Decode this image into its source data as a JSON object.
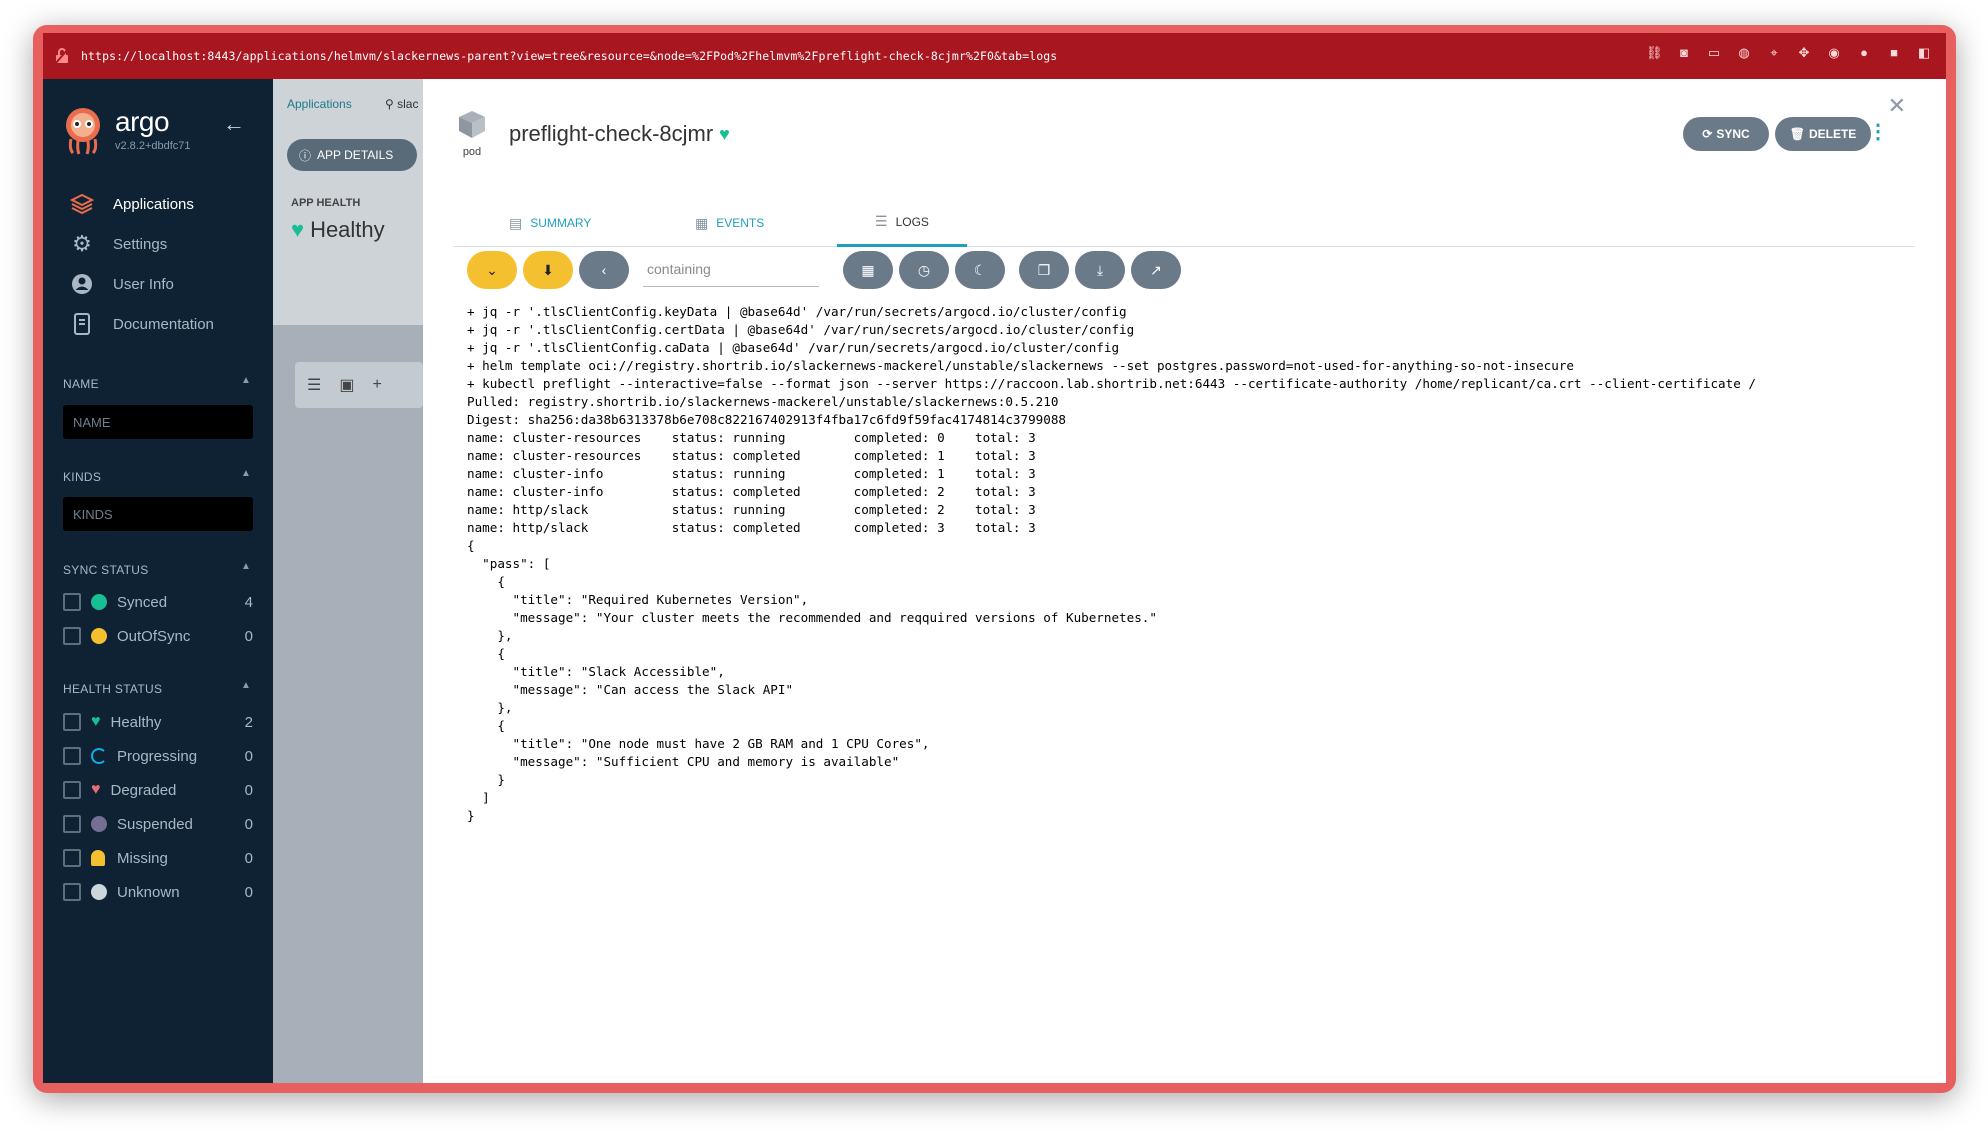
{
  "browser": {
    "url": "https://localhost:8443/applications/helmvm/slackernews-parent?view=tree&resource=&node=%2FPod%2Fhelmvm%2Fpreflight-check-8cjmr%2F0&tab=logs"
  },
  "sidebar": {
    "brand": "argo",
    "version": "v2.8.2+dbdfc71",
    "nav": [
      {
        "label": "Applications",
        "icon": "layers-icon"
      },
      {
        "label": "Settings",
        "icon": "gears-icon"
      },
      {
        "label": "User Info",
        "icon": "user-icon"
      },
      {
        "label": "Documentation",
        "icon": "book-icon"
      }
    ],
    "filters": {
      "name_title": "NAME",
      "name_placeholder": "NAME",
      "kinds_title": "KINDS",
      "kinds_placeholder": "KINDS",
      "sync_title": "SYNC STATUS",
      "sync": [
        {
          "label": "Synced",
          "count": "4",
          "color": "#18be94"
        },
        {
          "label": "OutOfSync",
          "count": "0",
          "color": "#f4c030"
        }
      ],
      "health_title": "HEALTH STATUS",
      "health": [
        {
          "label": "Healthy",
          "count": "2",
          "color": "#18be94"
        },
        {
          "label": "Progressing",
          "count": "0",
          "color": "#0dadea"
        },
        {
          "label": "Degraded",
          "count": "0",
          "color": "#e96d76"
        },
        {
          "label": "Suspended",
          "count": "0",
          "color": "#766f94"
        },
        {
          "label": "Missing",
          "count": "0",
          "color": "#f4c030"
        },
        {
          "label": "Unknown",
          "count": "0",
          "color": "#ccd6dd"
        }
      ]
    }
  },
  "app": {
    "breadcrumb": "Applications",
    "breadcrumb_search": "slac",
    "app_details_label": "APP DETAILS",
    "app_health_label": "APP HEALTH",
    "app_health_value": "Healthy"
  },
  "panel": {
    "kind": "pod",
    "title": "preflight-check-8cjmr",
    "sync_label": "SYNC",
    "delete_label": "DELETE",
    "tabs": [
      {
        "label": "SUMMARY",
        "icon": "file-icon"
      },
      {
        "label": "EVENTS",
        "icon": "calendar-icon"
      },
      {
        "label": "LOGS",
        "icon": "lines-icon"
      }
    ],
    "filter_placeholder": "containing",
    "log_lines": [
      "+ jq -r '.tlsClientConfig.keyData | @base64d' /var/run/secrets/argocd.io/cluster/config",
      "+ jq -r '.tlsClientConfig.certData | @base64d' /var/run/secrets/argocd.io/cluster/config",
      "+ jq -r '.tlsClientConfig.caData | @base64d' /var/run/secrets/argocd.io/cluster/config",
      "+ helm template oci://registry.shortrib.io/slackernews-mackerel/unstable/slackernews --set postgres.password=not-used-for-anything-so-not-insecure",
      "+ kubectl preflight --interactive=false --format json --server https://raccoon.lab.shortrib.net:6443 --certificate-authority /home/replicant/ca.crt --client-certificate /",
      "Pulled: registry.shortrib.io/slackernews-mackerel/unstable/slackernews:0.5.210",
      "Digest: sha256:da38b6313378b6e708c822167402913f4fba17c6fd9f59fac4174814c3799088",
      "name: cluster-resources    status: running         completed: 0    total: 3",
      "name: cluster-resources    status: completed       completed: 1    total: 3",
      "name: cluster-info         status: running         completed: 1    total: 3",
      "name: cluster-info         status: completed       completed: 2    total: 3",
      "name: http/slack           status: running         completed: 2    total: 3",
      "name: http/slack           status: completed       completed: 3    total: 3",
      "{",
      "  \"pass\": [",
      "    {",
      "      \"title\": \"Required Kubernetes Version\",",
      "      \"message\": \"Your cluster meets the recommended and reqquired versions of Kubernetes.\"",
      "    },",
      "    {",
      "      \"title\": \"Slack Accessible\",",
      "      \"message\": \"Can access the Slack API\"",
      "    },",
      "    {",
      "      \"title\": \"One node must have 2 GB RAM and 1 CPU Cores\",",
      "      \"message\": \"Sufficient CPU and memory is available\"",
      "    }",
      "  ]",
      "}"
    ]
  }
}
